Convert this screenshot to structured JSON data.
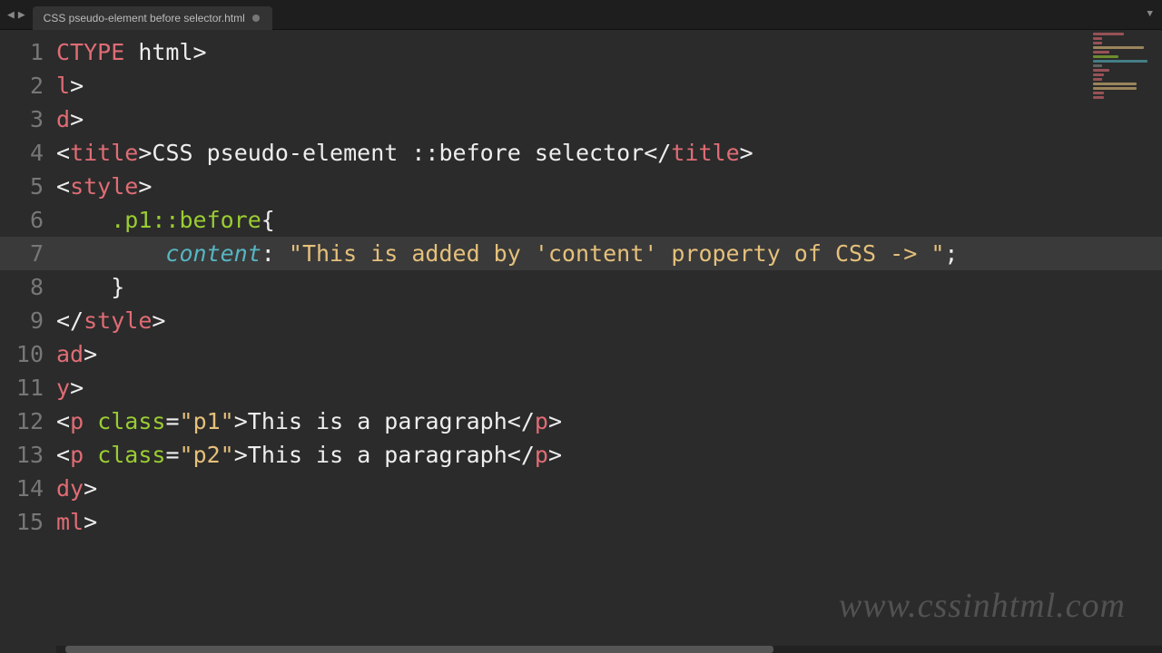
{
  "tab": {
    "filename": "CSS pseudo-element before selector.html",
    "dirty": true
  },
  "active_line": 7,
  "line_count": 15,
  "code_lines": [
    {
      "n": 1,
      "tokens": [
        {
          "t": "CTYPE",
          "c": "tag"
        },
        {
          "t": " html>",
          "c": "txt"
        }
      ]
    },
    {
      "n": 2,
      "tokens": [
        {
          "t": "l",
          "c": "tag"
        },
        {
          "t": ">",
          "c": "txt"
        }
      ]
    },
    {
      "n": 3,
      "tokens": [
        {
          "t": "d",
          "c": "tag"
        },
        {
          "t": ">",
          "c": "txt"
        }
      ]
    },
    {
      "n": 4,
      "tokens": [
        {
          "t": "<",
          "c": "txt"
        },
        {
          "t": "title",
          "c": "tag"
        },
        {
          "t": ">",
          "c": "txt"
        },
        {
          "t": "CSS pseudo-element ::before selector",
          "c": "txt"
        },
        {
          "t": "</",
          "c": "txt"
        },
        {
          "t": "title",
          "c": "tag"
        },
        {
          "t": ">",
          "c": "txt"
        }
      ]
    },
    {
      "n": 5,
      "tokens": [
        {
          "t": "<",
          "c": "txt"
        },
        {
          "t": "style",
          "c": "tag"
        },
        {
          "t": ">",
          "c": "txt"
        }
      ]
    },
    {
      "n": 6,
      "tokens": [
        {
          "t": "    ",
          "c": "txt"
        },
        {
          "t": ".p1::before",
          "c": "sel"
        },
        {
          "t": "{",
          "c": "txt"
        }
      ]
    },
    {
      "n": 7,
      "tokens": [
        {
          "t": "        ",
          "c": "txt"
        },
        {
          "t": "content",
          "c": "prop"
        },
        {
          "t": ":",
          "c": "txt"
        },
        {
          "t": " ",
          "c": "txt"
        },
        {
          "t": "\"This is added by 'content' property of CSS -> \"",
          "c": "str"
        },
        {
          "t": ";",
          "c": "txt"
        }
      ]
    },
    {
      "n": 8,
      "tokens": [
        {
          "t": "    }",
          "c": "txt"
        }
      ]
    },
    {
      "n": 9,
      "tokens": [
        {
          "t": "</",
          "c": "txt"
        },
        {
          "t": "style",
          "c": "tag"
        },
        {
          "t": ">",
          "c": "txt"
        }
      ]
    },
    {
      "n": 10,
      "tokens": [
        {
          "t": "ad",
          "c": "tag"
        },
        {
          "t": ">",
          "c": "txt"
        }
      ]
    },
    {
      "n": 11,
      "tokens": [
        {
          "t": "y",
          "c": "tag"
        },
        {
          "t": ">",
          "c": "txt"
        }
      ]
    },
    {
      "n": 12,
      "tokens": [
        {
          "t": "<",
          "c": "txt"
        },
        {
          "t": "p",
          "c": "tag"
        },
        {
          "t": " ",
          "c": "txt"
        },
        {
          "t": "class",
          "c": "attr"
        },
        {
          "t": "=",
          "c": "txt"
        },
        {
          "t": "\"p1\"",
          "c": "str"
        },
        {
          "t": ">",
          "c": "txt"
        },
        {
          "t": "This is a paragraph",
          "c": "txt"
        },
        {
          "t": "</",
          "c": "txt"
        },
        {
          "t": "p",
          "c": "tag"
        },
        {
          "t": ">",
          "c": "txt"
        }
      ]
    },
    {
      "n": 13,
      "tokens": [
        {
          "t": "<",
          "c": "txt"
        },
        {
          "t": "p",
          "c": "tag"
        },
        {
          "t": " ",
          "c": "txt"
        },
        {
          "t": "class",
          "c": "attr"
        },
        {
          "t": "=",
          "c": "txt"
        },
        {
          "t": "\"p2\"",
          "c": "str"
        },
        {
          "t": ">",
          "c": "txt"
        },
        {
          "t": "This is a paragraph",
          "c": "txt"
        },
        {
          "t": "</",
          "c": "txt"
        },
        {
          "t": "p",
          "c": "tag"
        },
        {
          "t": ">",
          "c": "txt"
        }
      ]
    },
    {
      "n": 14,
      "tokens": [
        {
          "t": "dy",
          "c": "tag"
        },
        {
          "t": ">",
          "c": "txt"
        }
      ]
    },
    {
      "n": 15,
      "tokens": [
        {
          "t": "ml",
          "c": "tag"
        },
        {
          "t": ">",
          "c": "txt"
        }
      ]
    }
  ],
  "watermark": "www.cssinhtml.com"
}
